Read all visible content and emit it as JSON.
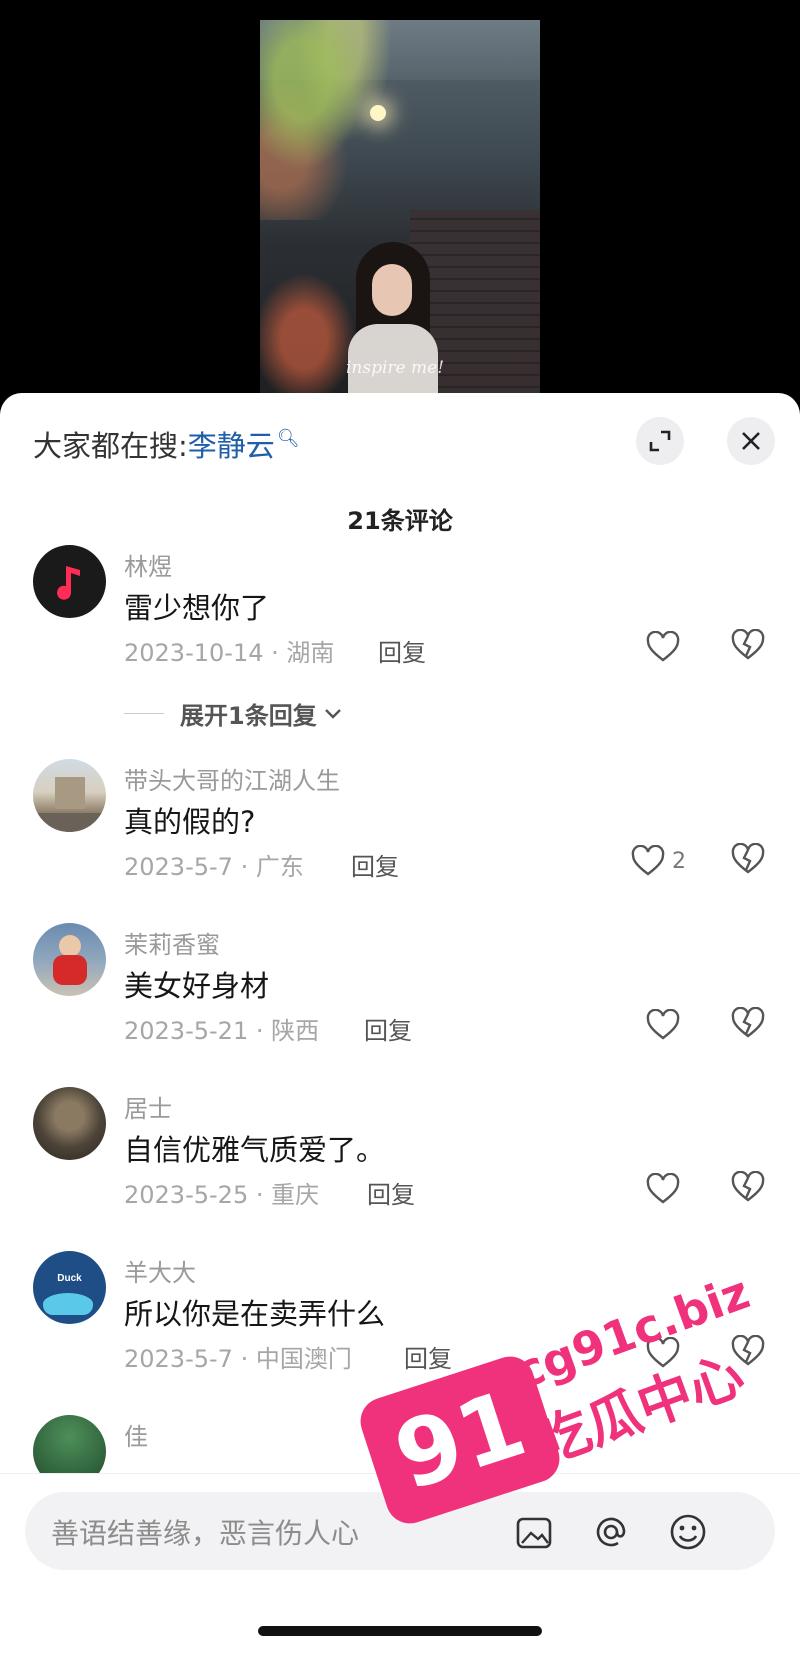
{
  "search": {
    "prefix": "大家都在搜:",
    "keyword": "李静云"
  },
  "comment_count_title": "21条评论",
  "video": {
    "caption": "inspire me!"
  },
  "comments": [
    {
      "name": "林煜",
      "text": "雷少想你了",
      "meta": "2023-10-14 · 湖南",
      "reply": "回复",
      "likes": "",
      "avatar": "music-app-logo"
    },
    {
      "name": "带头大哥的江湖人生",
      "text": "真的假的?",
      "meta": "2023-5-7 · 广东",
      "reply": "回复",
      "likes": "2",
      "avatar": "ruins-photo"
    },
    {
      "name": "茉莉香蜜",
      "text": "美女好身材",
      "meta": "2023-5-21 · 陕西",
      "reply": "回复",
      "likes": "",
      "avatar": "child-photo"
    },
    {
      "name": "居士",
      "text": "自信优雅气质爱了。",
      "meta": "2023-5-25 · 重庆",
      "reply": "回复",
      "likes": "",
      "avatar": "teapot-photo"
    },
    {
      "name": "羊大大",
      "text": "所以你是在卖弄什么",
      "meta": "2023-5-7 · 中国澳门",
      "reply": "回复",
      "likes": "",
      "avatar": "duck-illustration"
    },
    {
      "name": "佳",
      "text": "",
      "meta": "",
      "reply": "",
      "likes": "",
      "avatar": "green-photo"
    }
  ],
  "expand_replies": "展开1条回复",
  "input": {
    "placeholder": "善语结善缘，恶言伤人心"
  },
  "watermark": {
    "number": "91",
    "url": "cg91c.biz",
    "text": "吃瓜中心"
  },
  "colors": {
    "link_blue": "#1f5ea8",
    "watermark_pink": "#f0327c"
  }
}
